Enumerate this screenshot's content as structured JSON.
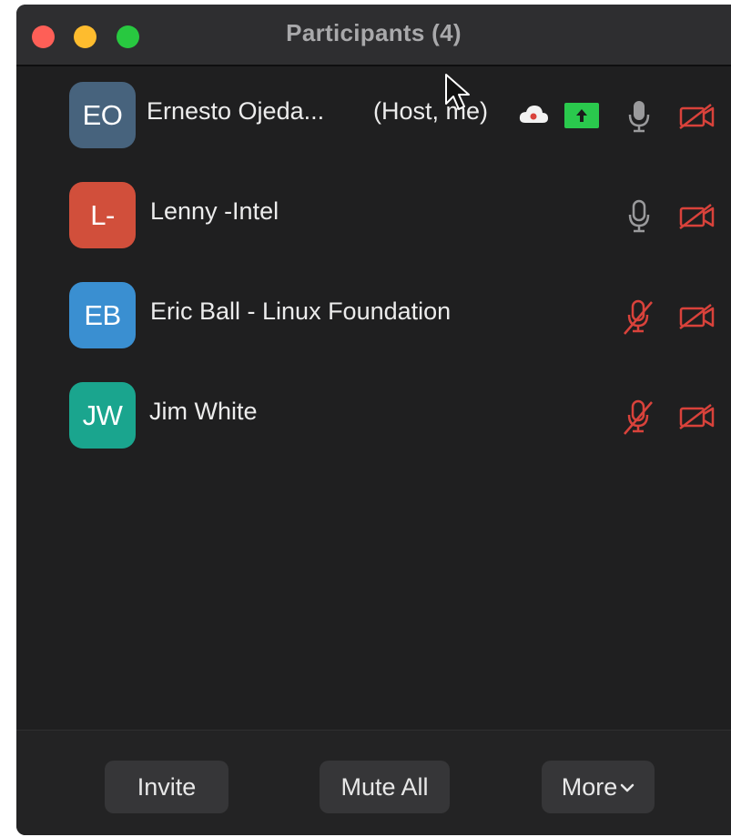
{
  "window": {
    "title": "Participants (4)"
  },
  "participants": [
    {
      "initials": "EO",
      "name": "Ernesto Ojeda...",
      "role": "(Host, me)",
      "avatar_color": "#47637d",
      "mic": "on",
      "video": "off",
      "recording": true,
      "sharing": true
    },
    {
      "initials": "L-",
      "name": "Lenny -Intel",
      "avatar_color": "#d14f3b",
      "mic": "on",
      "video": "off"
    },
    {
      "initials": "EB",
      "name": "Eric Ball - Linux Foundation",
      "avatar_color": "#3a8fd1",
      "mic": "muted",
      "video": "off"
    },
    {
      "initials": "JW",
      "name": "Jim White",
      "avatar_color": "#1aa58e",
      "mic": "muted",
      "video": "off"
    }
  ],
  "footer": {
    "invite_label": "Invite",
    "mute_all_label": "Mute All",
    "more_label": "More"
  },
  "colors": {
    "muted_red": "#d9423b",
    "share_green": "#2ac94d",
    "icon_gray": "#9a9a9c"
  },
  "icons": [
    "cloud-record-icon",
    "share-screen-icon",
    "microphone-icon",
    "mic-muted-icon",
    "video-off-icon",
    "chevron-down-icon",
    "mouse-pointer-icon"
  ]
}
